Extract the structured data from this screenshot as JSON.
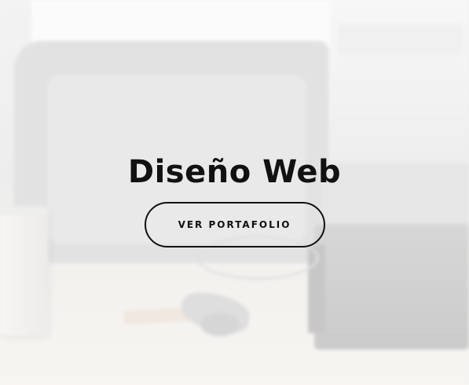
{
  "hero": {
    "title": "Diseño Web",
    "cta_label": "VER PORTAFOLIO"
  },
  "colors": {
    "text": "#111111",
    "background": "#f3f3f3"
  }
}
